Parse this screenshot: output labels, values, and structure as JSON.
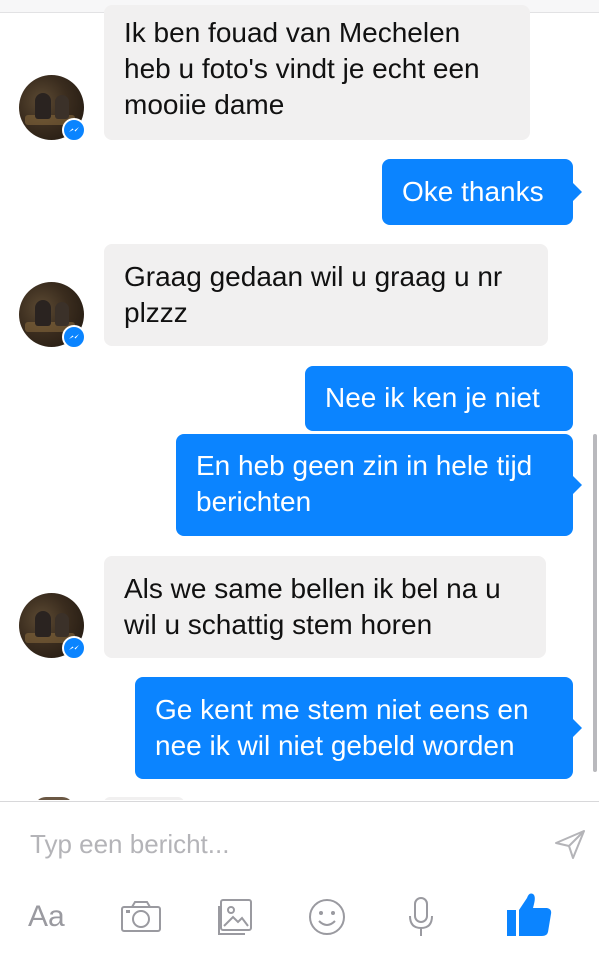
{
  "messages": [
    {
      "direction": "in",
      "text": "Ik ben fouad van Mechelen\nheb u foto's vindt je echt een\nmooiie dame"
    },
    {
      "direction": "out",
      "text": "Oke thanks"
    },
    {
      "direction": "in",
      "text": "Graag gedaan wil u graag u nr\nplzzz"
    },
    {
      "direction": "out",
      "text": "Nee ik ken je niet"
    },
    {
      "direction": "out",
      "text": "En heb geen zin in hele tijd\nberichten"
    },
    {
      "direction": "in",
      "text": "Als we same bellen ik bel na u\nwil u schattig stem horen"
    },
    {
      "direction": "out",
      "text": "Ge kent me stem niet eens en\nnee ik wil niet gebeld worden"
    }
  ],
  "composer": {
    "placeholder": "Typ een bericht...",
    "aa_label": "Aa",
    "icons": [
      "send-icon",
      "camera-icon",
      "gallery-icon",
      "emoji-icon",
      "microphone-icon",
      "thumbs-up-icon"
    ]
  },
  "colors": {
    "accent": "#0b84ff",
    "incoming_bubble": "#f1f0f0",
    "icon_gray": "#9a9aa0"
  }
}
